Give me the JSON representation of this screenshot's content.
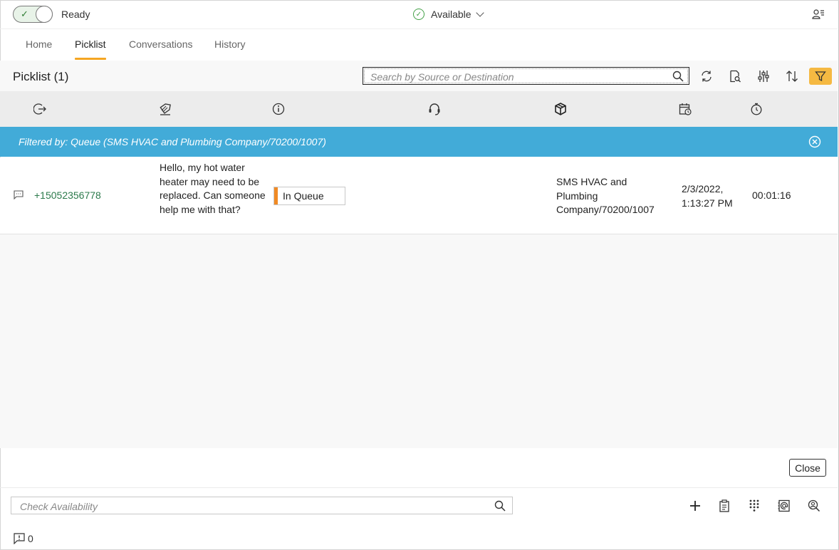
{
  "top": {
    "state_label": "Ready",
    "availability": "Available"
  },
  "tabs": [
    {
      "label": "Home"
    },
    {
      "label": "Picklist"
    },
    {
      "label": "Conversations"
    },
    {
      "label": "History"
    }
  ],
  "active_tab": "Picklist",
  "header": {
    "title": "Picklist (1)",
    "search_placeholder": "Search by Source or Destination"
  },
  "filter": {
    "text": "Filtered by: Queue (SMS HVAC and Plumbing Company/70200/1007)"
  },
  "rows": [
    {
      "source": "+15052356778",
      "message": "Hello, my hot water heater may need to be replaced. Can someone help me with that?",
      "status": "In Queue",
      "queue": "SMS HVAC and Plumbing Company/70200/1007",
      "date": "2/3/2022, 1:13:27 PM",
      "duration": "00:01:16"
    }
  ],
  "close_label": "Close",
  "footer": {
    "check_placeholder": "Check Availability",
    "alert_count": "0"
  },
  "colors": {
    "accent": "#f5a623",
    "filter_banner": "#42abd8",
    "status_queue": "#f08a24",
    "source_link": "#2b7a4b",
    "available": "#43a047"
  }
}
